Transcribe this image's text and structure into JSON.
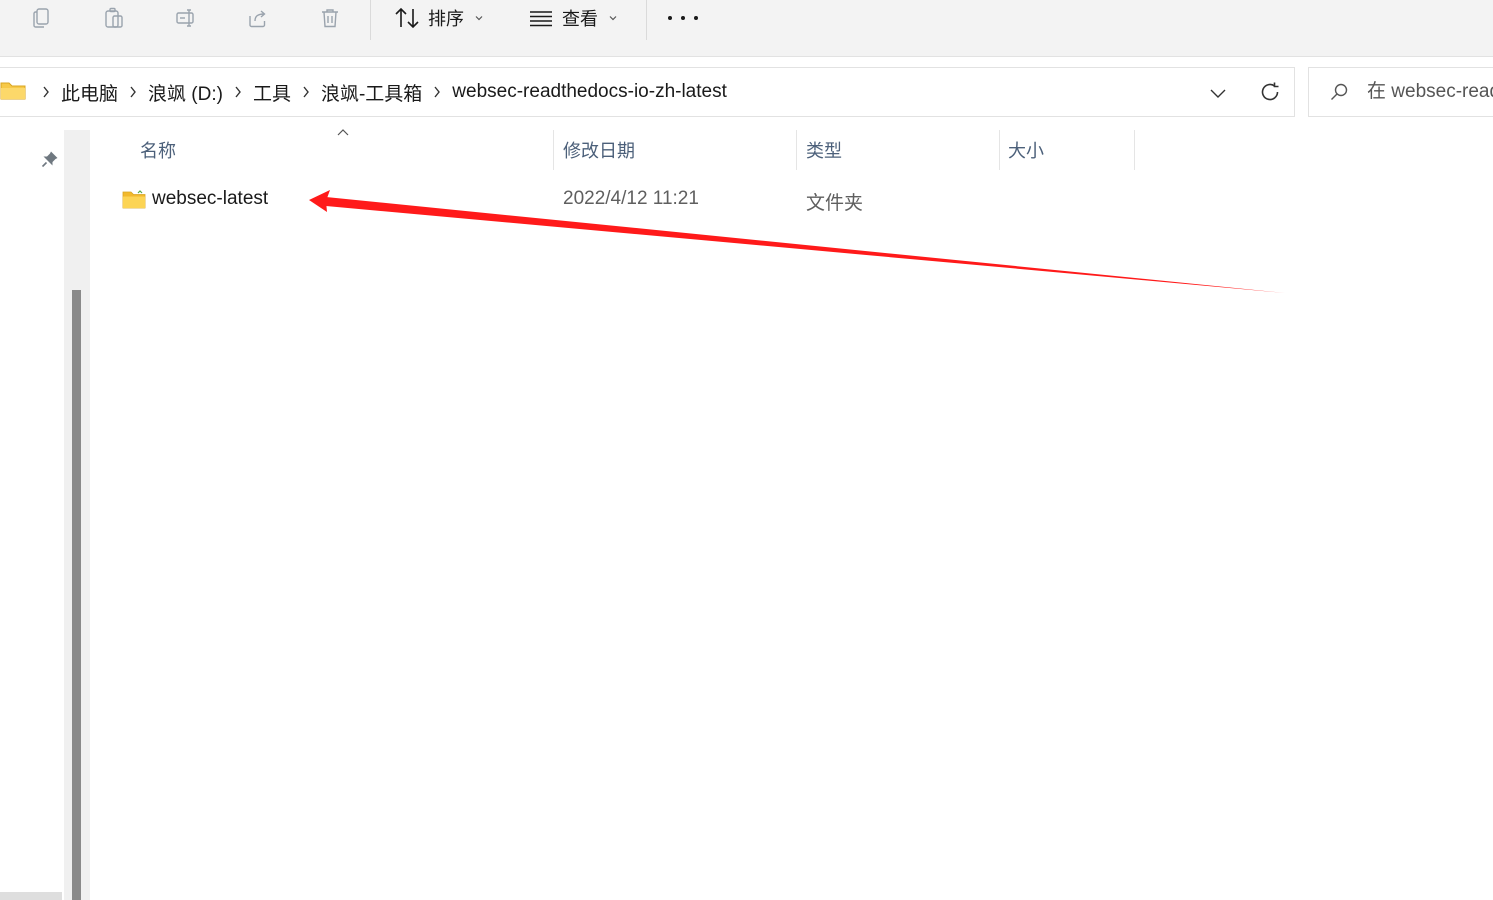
{
  "toolbar": {
    "icons": [
      "copy-icon",
      "paste-icon",
      "rename-icon",
      "share-icon",
      "delete-icon"
    ],
    "sort_label": "排序",
    "view_label": "查看",
    "more_label": "more-options"
  },
  "address": {
    "breadcrumbs": [
      "此电脑",
      "浪飒 (D:)",
      "工具",
      "浪飒-工具箱",
      "websec-readthedocs-io-zh-latest"
    ]
  },
  "search": {
    "placeholder": "在 websec-readthedocs-io-zh-latest 中搜索"
  },
  "columns": {
    "name": "名称",
    "modified": "修改日期",
    "type": "类型",
    "size": "大小"
  },
  "files": [
    {
      "name": "websec-latest",
      "modified": "2022/4/12 11:21",
      "type": "文件夹",
      "size": ""
    }
  ],
  "colors": {
    "toolbar_bg": "#f3f3f3",
    "header_text": "#4c607a",
    "folder_yellow": "#f7c948",
    "annotation_red": "#ff1a1a"
  }
}
